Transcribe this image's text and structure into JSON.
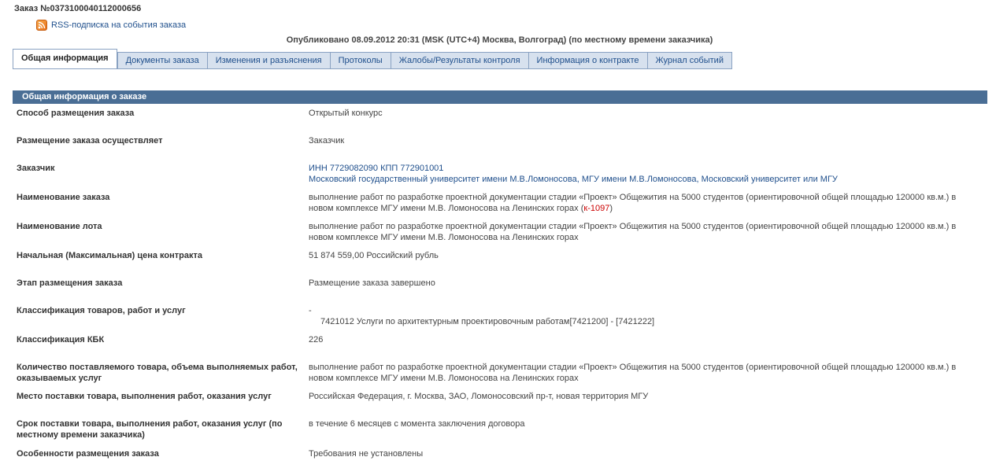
{
  "header": {
    "order_number": "Заказ №0373100040112000656",
    "rss_label": "RSS-подписка на события заказа",
    "published": "Опубликовано 08.09.2012 20:31 (MSK (UTC+4) Москва, Волгоград) (по местному времени заказчика)"
  },
  "tabs": [
    {
      "label": "Общая информация",
      "active": true
    },
    {
      "label": "Документы заказа"
    },
    {
      "label": "Изменения и разъяснения"
    },
    {
      "label": "Протоколы"
    },
    {
      "label": "Жалобы/Результаты контроля"
    },
    {
      "label": "Информация о контракте"
    },
    {
      "label": "Журнал событий"
    }
  ],
  "section": {
    "title": "Общая информация о заказе"
  },
  "fields": {
    "method": {
      "label": "Способ размещения заказа",
      "value": "Открытый конкурс"
    },
    "placer": {
      "label": "Размещение заказа осуществляет",
      "value": "Заказчик"
    },
    "customer": {
      "label": "Заказчик",
      "inn": "ИНН 7729082090 КПП 772901001",
      "name": "Московский государственный университет имени М.В.Ломоносова, МГУ имени М.В.Ломоносова, Московский университет или МГУ"
    },
    "order_name": {
      "label": "Наименование заказа",
      "value": "выполнение работ по разработке проектной документации стадии «Проект» Общежития на 5000 студентов (ориентировочной общей площадью 120000 кв.м.) в новом комплексе МГУ имени М.В. Ломоносова на Ленинских горах (",
      "code": "к-1097",
      "suffix": ")"
    },
    "lot_name": {
      "label": "Наименование лота",
      "value": "выполнение работ по разработке проектной документации стадии «Проект» Общежития на 5000 студентов (ориентировочной общей площадью 120000 кв.м.) в новом комплексе МГУ имени М.В. Ломоносова на Ленинских горах"
    },
    "price": {
      "label": "Начальная (Максимальная) цена контракта",
      "value": "51 874 559,00 Российский рубль"
    },
    "stage": {
      "label": "Этап размещения заказа",
      "value": "Размещение заказа завершено"
    },
    "classification": {
      "label": "Классификация товаров, работ и услуг",
      "dash": "-",
      "value": "7421012 Услуги по архитектурным проектировочным работам[7421200] - [7421222]"
    },
    "kbk": {
      "label": "Классификация КБК",
      "value": "226"
    },
    "quantity": {
      "label": "Количество поставляемого товара, объема выполняемых работ, оказываемых услуг",
      "value": "выполнение работ по разработке проектной документации стадии «Проект» Общежития на 5000 студентов (ориентировочной общей площадью 120000 кв.м.) в новом комплексе МГУ имени М.В. Ломоносова на Ленинских горах"
    },
    "place": {
      "label": "Место поставки товара, выполнения работ, оказания услуг",
      "value": "Российская Федерация, г. Москва, ЗАО, Ломоносовский пр-т, новая территория МГУ"
    },
    "term": {
      "label": "Срок поставки товара, выполнения работ, оказания услуг (по местному времени заказчика)",
      "value": "в течение 6 месяцев с момента заключения договора"
    },
    "features": {
      "label": "Особенности размещения заказа",
      "value": "Требования не установлены"
    }
  }
}
